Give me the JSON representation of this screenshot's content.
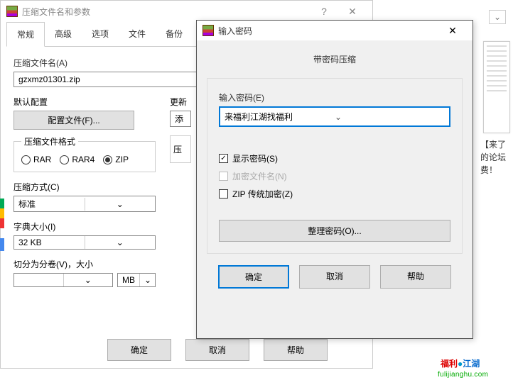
{
  "bg": {
    "title": "压缩文件名和参数",
    "help_glyph": "?",
    "close_glyph": "✕",
    "tabs": [
      "常规",
      "高级",
      "选项",
      "文件",
      "备份"
    ],
    "filename_label": "压缩文件名(A)",
    "filename_value": "gzxmz01301.zip",
    "default_cfg_label": "默认配置",
    "cfg_btn": "配置文件(F)...",
    "update_label_cut": "更新",
    "add_value_cut": "添",
    "format_legend": "压缩文件格式",
    "compress_label_cut": "压",
    "radios": {
      "rar": "RAR",
      "rar4": "RAR4",
      "zip": "ZIP"
    },
    "method_label": "压缩方式(C)",
    "method_value": "标准",
    "dict_label": "字典大小(I)",
    "dict_value": "32 KB",
    "split_label": "切分为分卷(V)，大小",
    "split_unit": "MB",
    "ok": "确定",
    "cancel": "取消",
    "help": "帮助"
  },
  "dlg": {
    "title": "输入密码",
    "close_glyph": "✕",
    "subtitle": "带密码压缩",
    "pwd_label": "输入密码(E)",
    "pwd_value": "来福利江湖找福利",
    "show_pwd": "显示密码(S)",
    "encrypt_names": "加密文件名(N)",
    "zip_legacy": "ZIP 传统加密(Z)",
    "organize": "整理密码(O)...",
    "ok": "确定",
    "cancel": "取消",
    "help": "帮助"
  },
  "right": {
    "dd_glyph": "⌄",
    "text_l1": "【来了",
    "text_l2": "的论坛",
    "text_l3": "费！",
    "logo_a": "福利",
    "logo_b": "江湖",
    "logo_url": "fulijianghu.com"
  }
}
